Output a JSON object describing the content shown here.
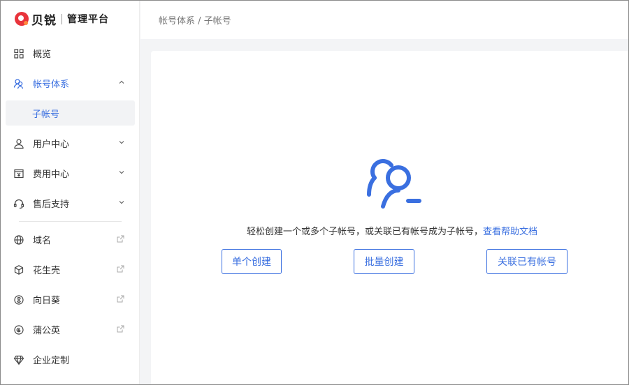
{
  "brand": {
    "name": "贝锐",
    "subtitle": "管理平台",
    "accent": "#e8343c"
  },
  "breadcrumb": {
    "parent": "帐号体系",
    "separator": "/",
    "current": "子帐号"
  },
  "sidebar": {
    "items": [
      {
        "label": "概览",
        "icon": "grid-icon"
      },
      {
        "label": "帐号体系",
        "icon": "users-icon",
        "expanded": true,
        "active": true
      },
      {
        "label": "子帐号",
        "sub": true,
        "selected": true
      },
      {
        "label": "用户中心",
        "icon": "user-icon"
      },
      {
        "label": "费用中心",
        "icon": "bill-icon"
      },
      {
        "label": "售后支持",
        "icon": "headset-icon"
      },
      {
        "label": "域名",
        "icon": "globe-icon",
        "external": true
      },
      {
        "label": "花生壳",
        "icon": "cube-icon",
        "external": true
      },
      {
        "label": "向日葵",
        "icon": "sunflower-icon",
        "external": true
      },
      {
        "label": "蒲公英",
        "icon": "dandelion-icon",
        "external": true
      },
      {
        "label": "企业定制",
        "icon": "diamond-icon"
      }
    ]
  },
  "main": {
    "empty_icon": "sub-account-icon",
    "description": "轻松创建一个或多个子帐号，或关联已有帐号成为子帐号，",
    "help_link": "查看帮助文档",
    "buttons": {
      "single": "单个创建",
      "batch": "批量创建",
      "link": "关联已有帐号"
    }
  },
  "colors": {
    "primary": "#3a6fe0",
    "text": "#333333",
    "muted": "#777777"
  }
}
